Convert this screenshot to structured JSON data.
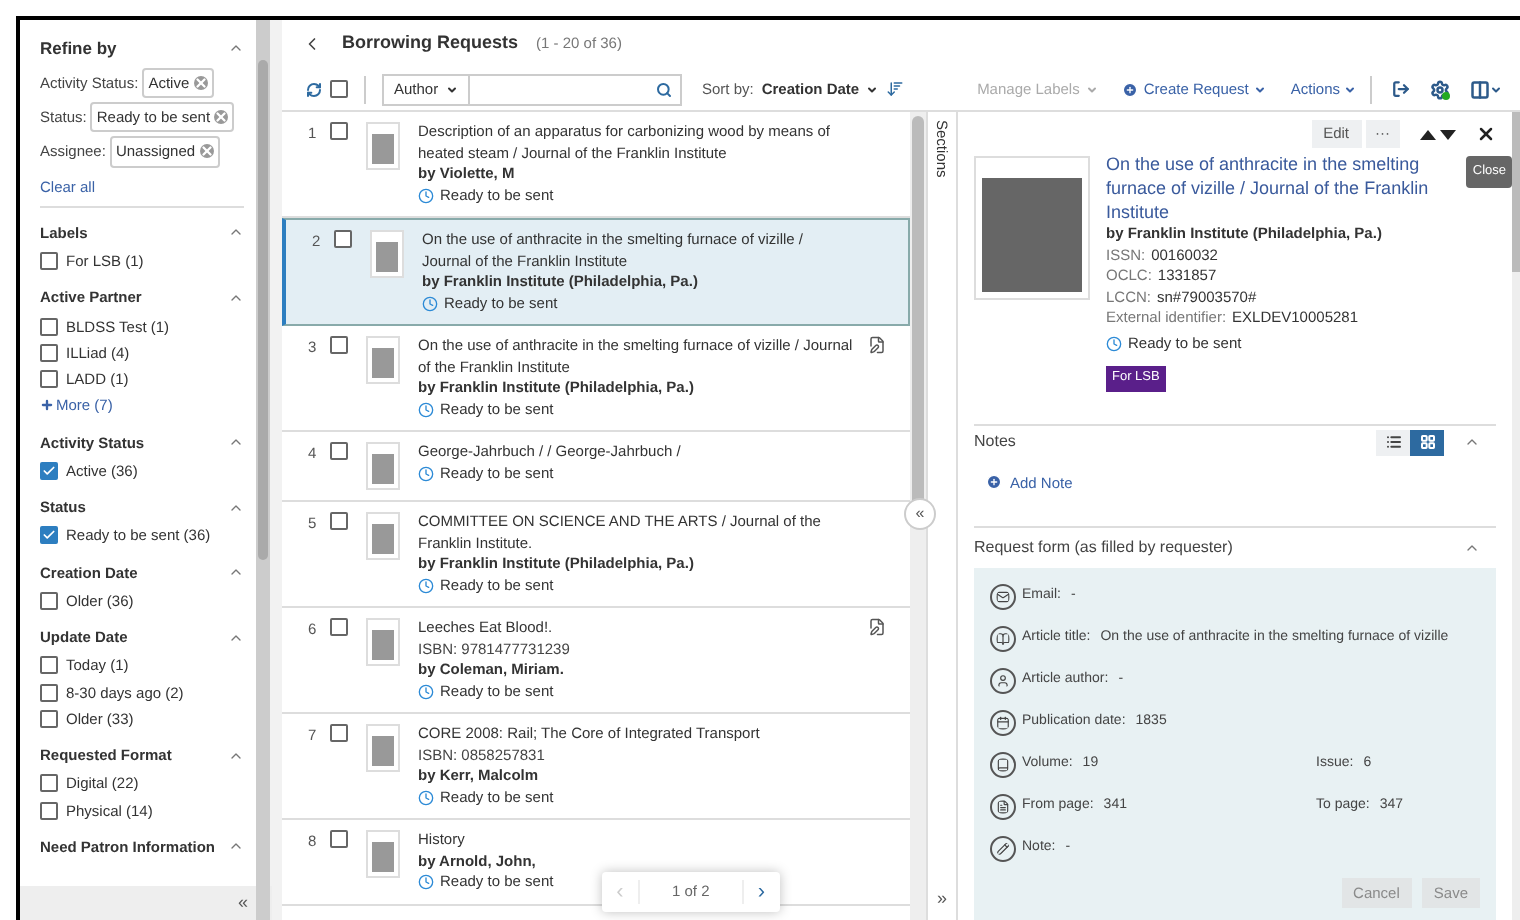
{
  "sidebar": {
    "title": "Refine by",
    "expanded": true,
    "active_filters": [
      {
        "label": "Activity Status:",
        "value": "Active"
      },
      {
        "label": "Status:",
        "value": "Ready to be sent"
      },
      {
        "label": "Assignee:",
        "value": "Unassigned"
      }
    ],
    "clear": "Clear all",
    "groups": [
      {
        "title": "Labels",
        "expanded": true,
        "options": [
          {
            "label": "For LSB (1)",
            "checked": false
          }
        ]
      },
      {
        "title": "Active Partner",
        "expanded": true,
        "options": [
          {
            "label": "BLDSS Test (1)",
            "checked": false
          },
          {
            "label": "ILLiad (4)",
            "checked": false
          },
          {
            "label": "LADD (1)",
            "checked": false
          }
        ],
        "more": "More (7)"
      },
      {
        "title": "Activity Status",
        "expanded": true,
        "options": [
          {
            "label": "Active (36)",
            "checked": true
          }
        ]
      },
      {
        "title": "Status",
        "expanded": true,
        "options": [
          {
            "label": "Ready to be sent (36)",
            "checked": true
          }
        ]
      },
      {
        "title": "Creation Date",
        "expanded": true,
        "options": [
          {
            "label": "Older (36)",
            "checked": false
          }
        ]
      },
      {
        "title": "Update Date",
        "expanded": true,
        "options": [
          {
            "label": "Today (1)",
            "checked": false
          },
          {
            "label": "8-30 days ago (2)",
            "checked": false
          },
          {
            "label": "Older (33)",
            "checked": false
          }
        ]
      },
      {
        "title": "Requested Format",
        "expanded": true,
        "options": [
          {
            "label": "Digital (22)",
            "checked": false
          },
          {
            "label": "Physical (14)",
            "checked": false
          }
        ]
      },
      {
        "title": "Need Patron Information",
        "expanded": true
      }
    ],
    "collapse": "«"
  },
  "header": {
    "title": "Borrowing Requests",
    "count": "(1 - 20 of 36)"
  },
  "toolbar": {
    "select_all": {
      "checked": false
    },
    "filter_field": "Author",
    "sort_label": "Sort by:",
    "sort_value": "Creation Date",
    "manage_labels": {
      "label": "Manage Labels",
      "disabled": true
    },
    "create_request": "Create Request",
    "actions": "Actions"
  },
  "requests": [
    {
      "number": "1",
      "checked": false,
      "selected": false,
      "title": "Description of an apparatus for carbonizing wood by means of heated steam / Journal of the Franklin Institute",
      "author": "by Violette, M",
      "status": "Ready to be sent",
      "note_icon": false
    },
    {
      "number": "2",
      "checked": false,
      "selected": true,
      "title": "On the use of anthracite in the smelting furnace of vizille / Journal of the Franklin Institute",
      "author": "by Franklin Institute (Philadelphia, Pa.)",
      "status": "Ready to be sent",
      "note_icon": false
    },
    {
      "number": "3",
      "checked": false,
      "selected": false,
      "title": "On the use of anthracite in the smelting furnace of vizille / Journal of the Franklin Institute",
      "author": "by Franklin Institute (Philadelphia, Pa.)",
      "status": "Ready to be sent",
      "note_icon": true
    },
    {
      "number": "4",
      "checked": false,
      "selected": false,
      "title": "George-Jahrbuch / / George-Jahrbuch /",
      "status": "Ready to be sent",
      "note_icon": false
    },
    {
      "number": "5",
      "checked": false,
      "selected": false,
      "title": "COMMITTEE ON SCIENCE AND THE ARTS / Journal of the Franklin Institute.",
      "author": "by Franklin Institute (Philadelphia, Pa.)",
      "status": "Ready to be sent",
      "note_icon": false
    },
    {
      "number": "6",
      "checked": false,
      "selected": false,
      "title": "Leeches Eat Blood!.",
      "isbn": "ISBN: 9781477731239",
      "author": "by Coleman, Miriam.",
      "status": "Ready to be sent",
      "note_icon": true
    },
    {
      "number": "7",
      "checked": false,
      "selected": false,
      "title": "CORE 2008: Rail; The Core of Integrated Transport",
      "isbn": "ISBN: 0858257831",
      "author": "by Kerr, Malcolm",
      "status": "Ready to be sent",
      "note_icon": false
    },
    {
      "number": "8",
      "checked": false,
      "selected": false,
      "title": "History",
      "author": "by Arnold, John,",
      "status": "Ready to be sent",
      "note_icon": false
    }
  ],
  "pager": {
    "prev": "‹",
    "prev_disabled": true,
    "text": "1 of 2",
    "next": "›"
  },
  "sections": {
    "title": "Sections",
    "collapse": "«",
    "expand": "»"
  },
  "detail": {
    "edit": "Edit",
    "more": "···",
    "tooltip": "Close",
    "title": "On the use of anthracite in the smelting furnace of vizille / Journal of the Franklin Institute",
    "author": "by Franklin Institute (Philadelphia, Pa.)",
    "fields": [
      {
        "label": "ISSN:",
        "value": "00160032"
      },
      {
        "label": "OCLC:",
        "value": "1331857"
      },
      {
        "label": "LCCN:",
        "value": "sn#79003570#"
      },
      {
        "label": "External identifier:",
        "value": "EXLDEV10005281"
      }
    ],
    "status": "Ready to be sent",
    "tag": "For LSB"
  },
  "notes": {
    "title": "Notes",
    "expanded": true,
    "view_modes": [
      {
        "kind": "list",
        "selected": false
      },
      {
        "kind": "grid",
        "selected": true
      }
    ],
    "add": "Add Note"
  },
  "request_form": {
    "title": "Request form (as filled by requester)",
    "expanded": true,
    "rows": [
      {
        "kind": "email",
        "cells": [
          {
            "label": "Email:",
            "value": "-"
          }
        ]
      },
      {
        "kind": "title",
        "cells": [
          {
            "label": "Article title:",
            "value": "On the use of anthracite in the smelting furnace of vizille"
          }
        ]
      },
      {
        "kind": "author",
        "cells": [
          {
            "label": "Article author:",
            "value": "-"
          }
        ]
      },
      {
        "kind": "date",
        "cells": [
          {
            "label": "Publication date:",
            "value": "1835"
          }
        ]
      },
      {
        "kind": "volume",
        "cells": [
          {
            "label": "Volume:",
            "value": "19"
          },
          {
            "label": "Issue:",
            "value": "6"
          }
        ]
      },
      {
        "kind": "page",
        "cells": [
          {
            "label": "From page:",
            "value": "341"
          },
          {
            "label": "To page:",
            "value": "347"
          }
        ]
      },
      {
        "kind": "note",
        "cells": [
          {
            "label": "Note:",
            "value": "-"
          }
        ]
      }
    ],
    "buttons": [
      {
        "label": "Cancel",
        "disabled": true
      },
      {
        "label": "Save",
        "disabled": true
      }
    ]
  }
}
